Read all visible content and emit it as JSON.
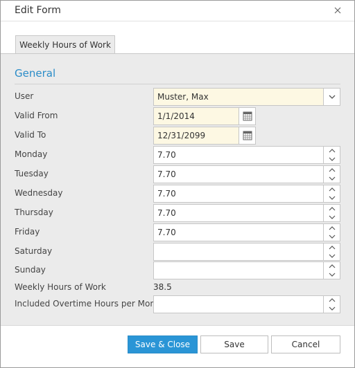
{
  "dialog": {
    "title": "Edit Form"
  },
  "tabs": [
    {
      "label": "Weekly Hours of Work"
    }
  ],
  "section": {
    "title": "General"
  },
  "fields": {
    "user": {
      "label": "User",
      "value": "Muster, Max"
    },
    "valid_from": {
      "label": "Valid From",
      "value": "1/1/2014"
    },
    "valid_to": {
      "label": "Valid To",
      "value": "12/31/2099"
    },
    "monday": {
      "label": "Monday",
      "value": "7.70"
    },
    "tuesday": {
      "label": "Tuesday",
      "value": "7.70"
    },
    "wednesday": {
      "label": "Wednesday",
      "value": "7.70"
    },
    "thursday": {
      "label": "Thursday",
      "value": "7.70"
    },
    "friday": {
      "label": "Friday",
      "value": "7.70"
    },
    "saturday": {
      "label": "Saturday",
      "value": ""
    },
    "sunday": {
      "label": "Sunday",
      "value": ""
    },
    "weekly_hours": {
      "label": "Weekly Hours of Work",
      "value": "38.5"
    },
    "overtime": {
      "label": "Included Overtime Hours per Month",
      "value": ""
    }
  },
  "buttons": {
    "save_close": "Save & Close",
    "save": "Save",
    "cancel": "Cancel"
  },
  "colors": {
    "accent": "#2a95d6",
    "section_title": "#2a8cc8",
    "highlight_field": "#fdf8e3",
    "panel": "#ebebeb"
  },
  "icons": {
    "close": "close-icon",
    "dropdown": "chevron-down-icon",
    "calendar": "calendar-icon",
    "spin_up": "chevron-up-icon",
    "spin_down": "chevron-down-icon"
  }
}
